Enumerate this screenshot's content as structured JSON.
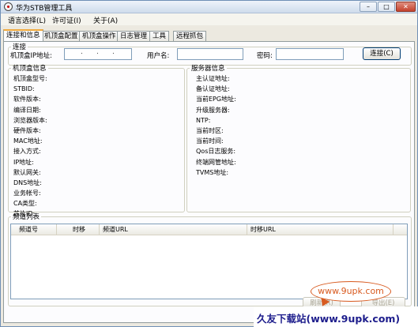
{
  "window": {
    "title": "华为STB管理工具"
  },
  "titlebar_buttons": {
    "minimize": "–",
    "maximize": "□",
    "close": "✕"
  },
  "menu": [
    "语言选择(L)",
    "许可证(I)",
    "关于(A)"
  ],
  "tabs": [
    "连接和信息",
    "机顶盒配置",
    "机顶盒操作",
    "日志管理",
    "工具",
    "远程抓包"
  ],
  "connection": {
    "legend": "连接",
    "ip_label": "机顶盒IP地址:",
    "ip_dot": ".",
    "username_label": "用户名:",
    "username_value": "",
    "password_label": "密码:",
    "password_value": "",
    "connect_button": "连接(C)"
  },
  "stb_info": {
    "legend": "机顶盒信息",
    "fields": [
      "机顶盒型号:",
      "STBID:",
      "软件版本:",
      "编译日期:",
      "浏览器版本:",
      "硬件版本:",
      "MAC地址:",
      "接入方式:",
      "IP地址:",
      "默认网关:",
      "DNS地址:",
      "业务帐号:",
      "CA类型:",
      "芯片ID:"
    ]
  },
  "server_info": {
    "legend": "服务器信息",
    "fields": [
      "主认证地址:",
      "备认证地址:",
      "当前EPG地址:",
      "升级服务器:",
      "NTP:",
      "当前时区:",
      "当前时间:",
      "Qos日志服务:",
      "终端网管地址:",
      "TVMS地址:"
    ]
  },
  "channel_list": {
    "legend": "频道列表",
    "columns": [
      "频道号",
      "时移",
      "频道URL",
      "时移URL"
    ],
    "rows": []
  },
  "bottom_buttons": {
    "refresh": "刷新(R)",
    "export": "导出(E)"
  },
  "watermark": {
    "url": "www.9upk.com",
    "text": "久友下载站(www.9upk.com)"
  }
}
